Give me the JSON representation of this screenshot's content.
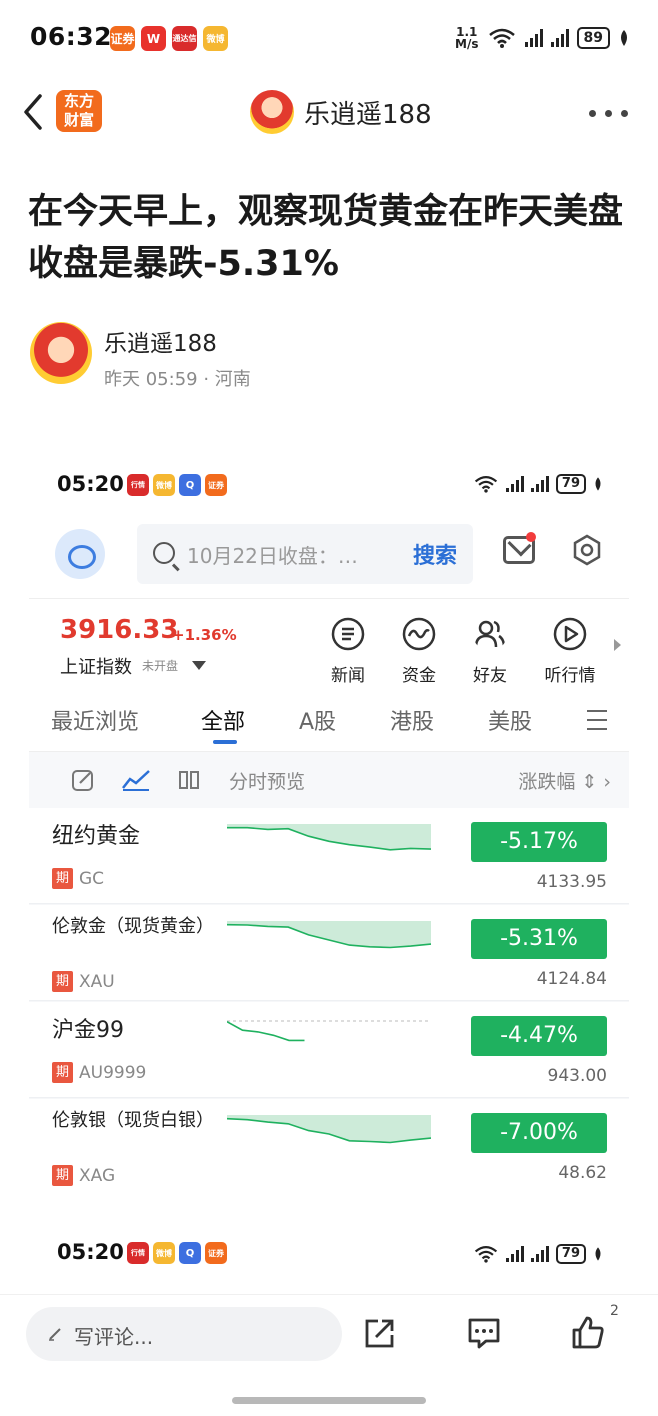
{
  "status_bar": {
    "time": "06:32",
    "net_speed_value": "1.1",
    "net_speed_unit": "M/s",
    "battery": "89",
    "app_icons": [
      "证券",
      "W",
      "通达信",
      "微博"
    ]
  },
  "nav": {
    "logo_line1": "东方",
    "logo_line2": "财富",
    "title": "乐逍遥188"
  },
  "article": {
    "title": "在今天早上，观察现货黄金在昨天美盘收盘是暴跌-5.31%",
    "author_name": "乐逍遥188",
    "meta": "昨天 05:59 · 河南"
  },
  "shot": {
    "status": {
      "time": "05:20",
      "battery": "79",
      "app_icons": [
        "行情",
        "微博",
        "Q",
        "证券"
      ]
    },
    "search": {
      "placeholder": "10月22日收盘：…",
      "button": "搜索"
    },
    "index": {
      "value": "3916.33",
      "change": "+1.36%",
      "name": "上证指数",
      "status": "未开盘"
    },
    "quick_actions": [
      "新闻",
      "资金",
      "好友",
      "听行情"
    ],
    "tabs": [
      "最近浏览",
      "全部",
      "A股",
      "港股",
      "美股"
    ],
    "active_tab": "全部",
    "toolbar": {
      "label": "分时预览",
      "sort": "涨跌幅"
    },
    "tag_label": "期",
    "rows": [
      {
        "name": "纽约黄金",
        "code": "GC",
        "change": "-5.17%",
        "price": "4133.95",
        "trend": [
          0.05,
          0.05,
          0.1,
          0.08,
          0.3,
          0.45,
          0.55,
          0.62,
          0.7,
          0.66,
          0.68
        ]
      },
      {
        "name": "伦敦金（现货黄金）",
        "code": "XAU",
        "change": "-5.31%",
        "price": "4124.84",
        "trend": [
          0.05,
          0.06,
          0.1,
          0.12,
          0.35,
          0.5,
          0.65,
          0.7,
          0.72,
          0.68,
          0.62
        ]
      },
      {
        "name": "沪金99",
        "code": "AU9999",
        "change": "-4.47%",
        "price": "943.00",
        "trend": [
          0.05,
          0.3,
          0.35,
          0.45,
          0.6,
          0.6
        ]
      },
      {
        "name": "伦敦银（现货白银）",
        "code": "XAG",
        "change": "-7.00%",
        "price": "48.62",
        "trend": [
          0.05,
          0.08,
          0.15,
          0.2,
          0.4,
          0.5,
          0.7,
          0.72,
          0.75,
          0.68,
          0.62
        ]
      }
    ]
  },
  "shot2_status": {
    "time": "05:20",
    "battery": "79",
    "app_icons": [
      "行情",
      "微博",
      "Q",
      "证券"
    ]
  },
  "bottom": {
    "comment_placeholder": "写评论...",
    "like_count": "2"
  },
  "colors": {
    "up": "#e13a2e",
    "down": "#1fb15f",
    "accent": "#2b6fd6"
  }
}
